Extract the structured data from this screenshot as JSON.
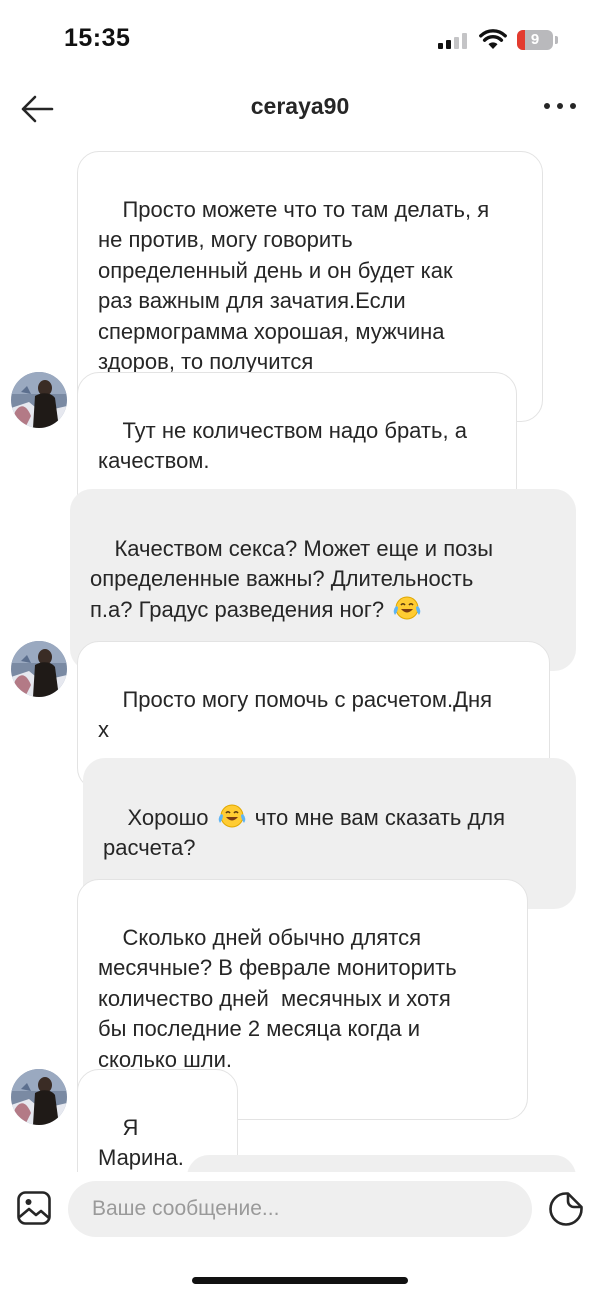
{
  "status_bar": {
    "time": "15:35",
    "battery_level": "9",
    "battery_color": "#e33b2f"
  },
  "header": {
    "title": "ceraya90",
    "back_icon": "arrow-left-icon",
    "more_icon": "ellipsis-icon"
  },
  "messages": [
    {
      "direction": "incoming",
      "avatar": false,
      "text": "Просто можете что то там делать, я\nне против, могу говорить\nопределенный день и он будет как\nраз важным для зачатия.Если\nспермограмма хорошая, мужчина\nздоров, то получится"
    },
    {
      "direction": "incoming",
      "avatar": true,
      "text": "Тут не количеством надо брать, а\nкачеством."
    },
    {
      "direction": "outgoing",
      "avatar": false,
      "text": "Качеством секса? Может еще и позы\nопределенные важны? Длительность\nп.а? Градус разведения ног? ",
      "emoji": "face-with-tears-of-joy"
    },
    {
      "direction": "incoming",
      "avatar": true,
      "text": "Просто могу помочь с расчетом.Дня\nх"
    },
    {
      "direction": "outgoing",
      "avatar": false,
      "text_before": "Хорошо ",
      "emoji": "face-with-tears-of-joy",
      "text_after": " что мне вам сказать для\nрасчета?"
    },
    {
      "direction": "incoming",
      "avatar": false,
      "text": "Сколько дней обычно длятся\nмесячные? В феврале мониторить\nколичество дней  месячных и хотя\nбы последние 2 месяца когда и\nсколько шли."
    },
    {
      "direction": "incoming",
      "avatar": true,
      "text": "Я Марина."
    }
  ],
  "composer": {
    "placeholder": "Ваше сообщение...",
    "gallery_icon": "image-gallery-icon",
    "sticker_icon": "sticker-icon"
  },
  "colors": {
    "incoming_bubble": "#ffffff",
    "incoming_border": "#e3e3e3",
    "outgoing_bubble": "#efefef",
    "text": "#262626",
    "placeholder": "#9a9a9a"
  }
}
